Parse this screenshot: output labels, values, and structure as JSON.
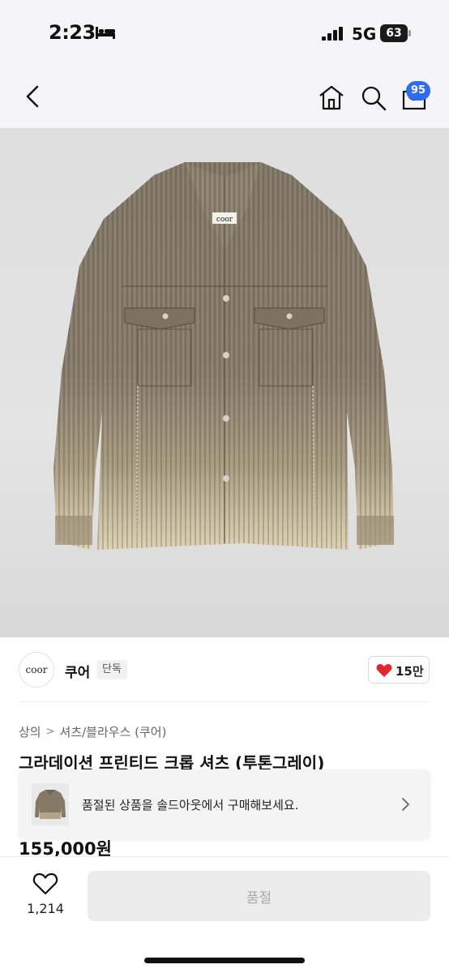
{
  "status_bar": {
    "time": "2:23",
    "network": "5G",
    "battery": "63"
  },
  "nav": {
    "cart_count": "95"
  },
  "brand": {
    "logo_text": "coor",
    "name": "쿠어",
    "tag": "단독"
  },
  "likes": {
    "count": "15만"
  },
  "breadcrumb": {
    "items": [
      "상의",
      "셔츠/블라우스 (쿠어)"
    ]
  },
  "product": {
    "title": "그라데이션 프린티드 크롭 셔츠 (투톤그레이)",
    "price": "155,000원",
    "label_text": "coor"
  },
  "soldout_banner": {
    "text": "품절된 상품을 솔드아웃에서 구매해보세요."
  },
  "bottom_bar": {
    "wish_count": "1,214",
    "button_label": "품절"
  },
  "colors": {
    "badge": "#2f6bf0",
    "heart": "#e0282e",
    "button_bg": "#ececec"
  }
}
